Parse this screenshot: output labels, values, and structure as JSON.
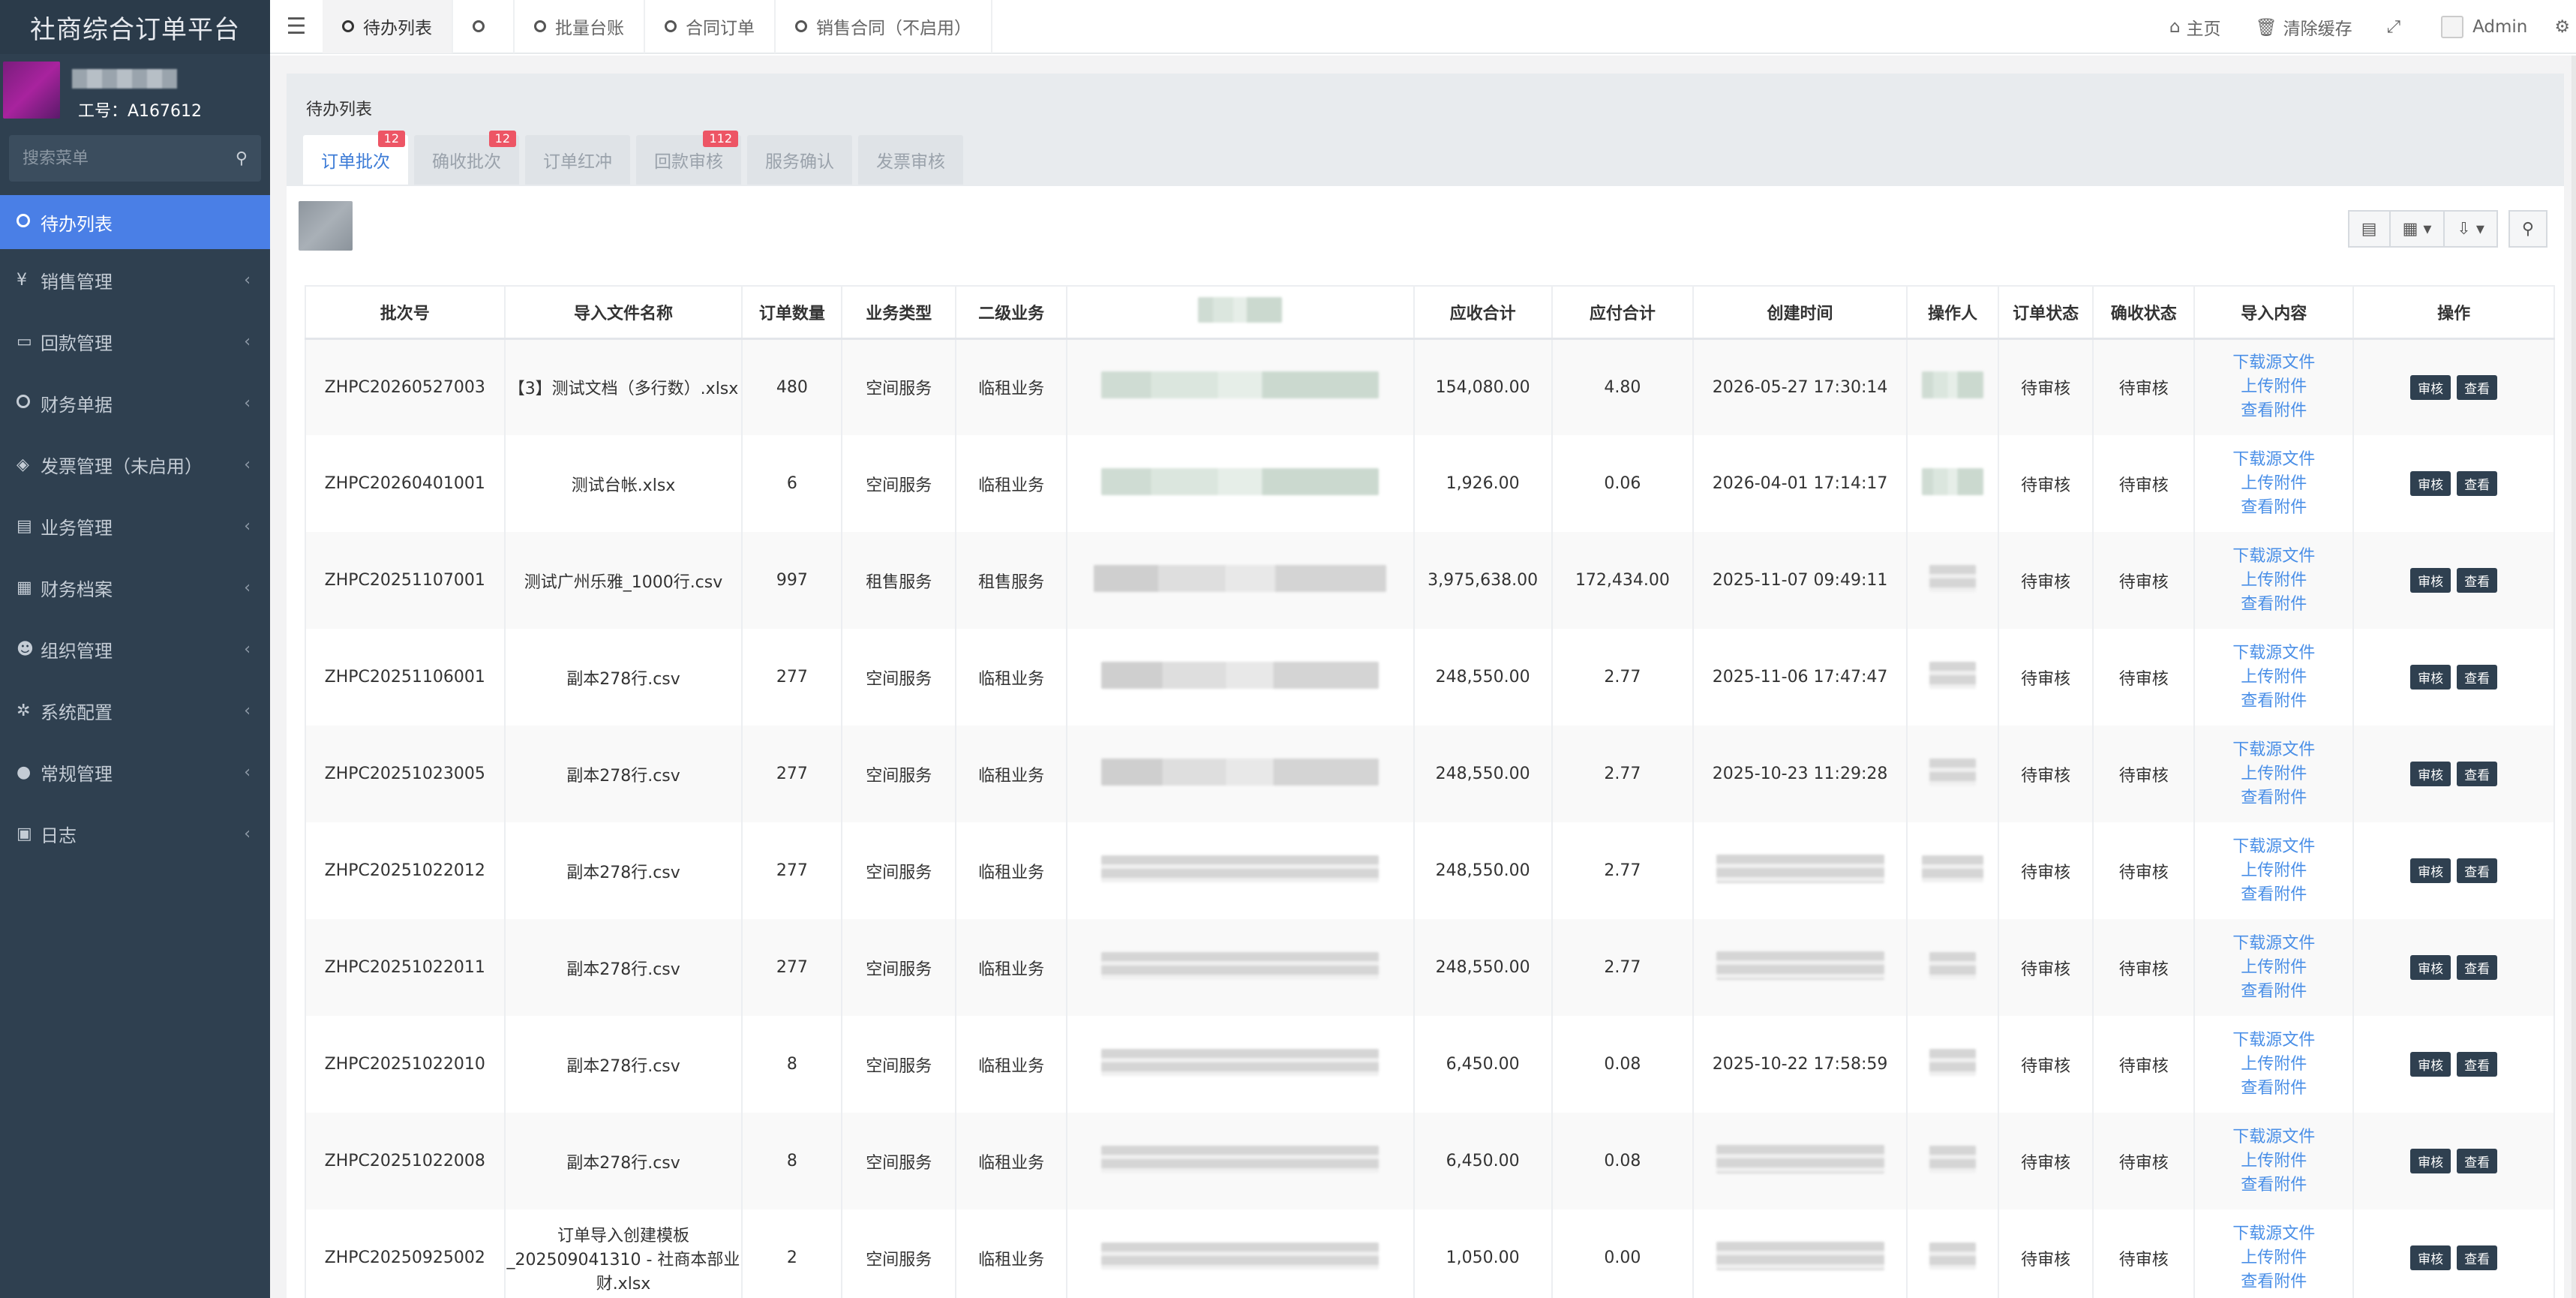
{
  "app": {
    "title": "社商综合订单平台"
  },
  "user": {
    "job_no": "工号：A167612"
  },
  "sidebar": {
    "search_placeholder": "搜索菜单",
    "items": [
      {
        "label": "待办列表",
        "icon": "circle-icon",
        "glyph": "",
        "active": true
      },
      {
        "label": "销售管理",
        "icon": "yen-icon",
        "glyph": "¥"
      },
      {
        "label": "回款管理",
        "icon": "credit-card-icon",
        "glyph": "▭"
      },
      {
        "label": "财务单据",
        "icon": "circle-icon",
        "glyph": ""
      },
      {
        "label": "发票管理（未启用）",
        "icon": "tag-icon",
        "glyph": "◈"
      },
      {
        "label": "业务管理",
        "icon": "list-icon",
        "glyph": "▤"
      },
      {
        "label": "财务档案",
        "icon": "calculator-icon",
        "glyph": "▦"
      },
      {
        "label": "组织管理",
        "icon": "users-icon",
        "glyph": "☻"
      },
      {
        "label": "系统配置",
        "icon": "gears-icon",
        "glyph": "✲"
      },
      {
        "label": "常规管理",
        "icon": "user-icon",
        "glyph": "●"
      },
      {
        "label": "日志",
        "icon": "bus-icon",
        "glyph": "▣"
      }
    ]
  },
  "topbar": {
    "tabs": [
      {
        "label": "待办列表",
        "active": true
      },
      {
        "label": ""
      },
      {
        "label": "批量台账"
      },
      {
        "label": "合同订单"
      },
      {
        "label": "销售合同（不启用）"
      }
    ],
    "home": "主页",
    "clear_cache": "清除缓存",
    "admin": "Admin"
  },
  "panel": {
    "title": "待办列表",
    "subtabs": [
      {
        "label": "订单批次",
        "badge": "12",
        "active": true
      },
      {
        "label": "确收批次",
        "badge": "12"
      },
      {
        "label": "订单红冲",
        "badge": ""
      },
      {
        "label": "回款审核",
        "badge": "112"
      },
      {
        "label": "服务确认",
        "badge": ""
      },
      {
        "label": "发票审核",
        "badge": ""
      }
    ]
  },
  "table": {
    "headers": [
      "批次号",
      "导入文件名称",
      "订单数量",
      "业务类型",
      "二级业务",
      "",
      "应收合计",
      "应付合计",
      "创建时间",
      "操作人",
      "订单状态",
      "确收状态",
      "导入内容",
      "操作"
    ],
    "link_labels": [
      "下载源文件",
      "上传附件",
      "查看附件"
    ],
    "btn_audit": "审核",
    "btn_view": "查看",
    "rows": [
      {
        "batch": "ZHPC20260527003",
        "file": "【3】测试文档（多行数）.xlsx",
        "qty": "480",
        "biz": "空间服务",
        "sub": "临租业务",
        "recv": "154,080.00",
        "pay": "4.80",
        "created": "2026-05-27 17:30:14",
        "order_status": "待审核",
        "confirm_status": "待审核"
      },
      {
        "batch": "ZHPC20260401001",
        "file": "测试台帐.xlsx",
        "qty": "6",
        "biz": "空间服务",
        "sub": "临租业务",
        "recv": "1,926.00",
        "pay": "0.06",
        "created": "2026-04-01 17:14:17",
        "order_status": "待审核",
        "confirm_status": "待审核"
      },
      {
        "batch": "ZHPC20251107001",
        "file": "测试广州乐雅_1000行.csv",
        "qty": "997",
        "biz": "租售服务",
        "sub": "租售服务",
        "recv": "3,975,638.00",
        "pay": "172,434.00",
        "created": "2025-11-07 09:49:11",
        "order_status": "待审核",
        "confirm_status": "待审核"
      },
      {
        "batch": "ZHPC20251106001",
        "file": "副本278行.csv",
        "qty": "277",
        "biz": "空间服务",
        "sub": "临租业务",
        "recv": "248,550.00",
        "pay": "2.77",
        "created": "2025-11-06 17:47:47",
        "order_status": "待审核",
        "confirm_status": "待审核"
      },
      {
        "batch": "ZHPC20251023005",
        "file": "副本278行.csv",
        "qty": "277",
        "biz": "空间服务",
        "sub": "临租业务",
        "recv": "248,550.00",
        "pay": "2.77",
        "created": "2025-10-23 11:29:28",
        "order_status": "待审核",
        "confirm_status": "待审核"
      },
      {
        "batch": "ZHPC20251022012",
        "file": "副本278行.csv",
        "qty": "277",
        "biz": "空间服务",
        "sub": "临租业务",
        "recv": "248,550.00",
        "pay": "2.77",
        "created": "",
        "order_status": "待审核",
        "confirm_status": "待审核"
      },
      {
        "batch": "ZHPC20251022011",
        "file": "副本278行.csv",
        "qty": "277",
        "biz": "空间服务",
        "sub": "临租业务",
        "recv": "248,550.00",
        "pay": "2.77",
        "created": "",
        "order_status": "待审核",
        "confirm_status": "待审核"
      },
      {
        "batch": "ZHPC20251022010",
        "file": "副本278行.csv",
        "qty": "8",
        "biz": "空间服务",
        "sub": "临租业务",
        "recv": "6,450.00",
        "pay": "0.08",
        "created": "2025-10-22 17:58:59",
        "order_status": "待审核",
        "confirm_status": "待审核"
      },
      {
        "batch": "ZHPC20251022008",
        "file": "副本278行.csv",
        "qty": "8",
        "biz": "空间服务",
        "sub": "临租业务",
        "recv": "6,450.00",
        "pay": "0.08",
        "created": "",
        "order_status": "待审核",
        "confirm_status": "待审核"
      },
      {
        "batch": "ZHPC20250925002",
        "file": "订单导入创建模板_202509041310 - 社商本部业财.xlsx",
        "qty": "2",
        "biz": "空间服务",
        "sub": "临租业务",
        "recv": "1,050.00",
        "pay": "0.00",
        "created": "",
        "order_status": "待审核",
        "confirm_status": "待审核"
      }
    ]
  }
}
